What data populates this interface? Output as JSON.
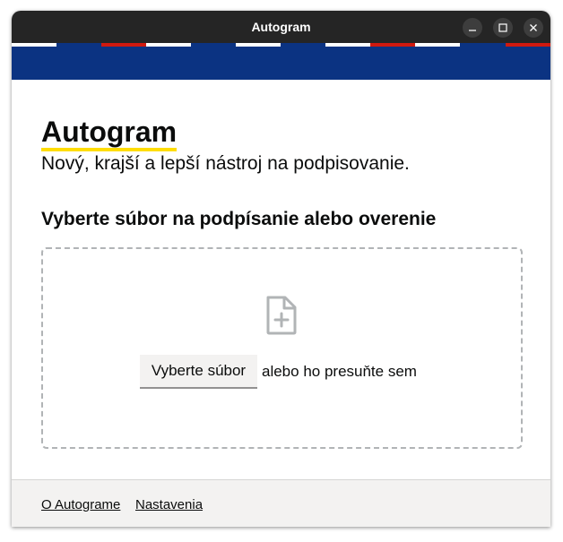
{
  "window": {
    "title": "Autogram",
    "controls": {
      "minimize_icon": "minimize-icon",
      "maximize_icon": "maximize-icon",
      "close_icon": "close-icon"
    }
  },
  "header": {
    "band_color": "#0b3382",
    "stripe_accent_red": "#d0190f",
    "stripe_accent_white": "#ffffff"
  },
  "main": {
    "app_title": "Autogram",
    "app_title_underline_color": "#ffdd00",
    "subtitle": "Nový, krajší a lepší nástroj na podpisovanie.",
    "section_title": "Vyberte súbor na podpísanie alebo overenie",
    "dropzone": {
      "icon": "file-plus-icon",
      "button_label": "Vyberte súbor",
      "hint_text": "alebo ho presuňte sem"
    }
  },
  "footer": {
    "links": [
      {
        "label": "O Autograme"
      },
      {
        "label": "Nastavenia"
      }
    ]
  }
}
